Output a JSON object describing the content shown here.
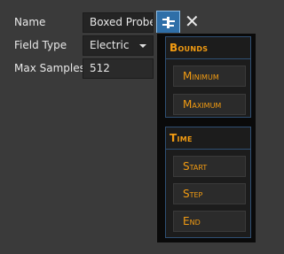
{
  "form": {
    "name_label": "Name",
    "name_value": "Boxed Probe",
    "field_type_label": "Field Type",
    "field_type_value": "Electric",
    "max_samples_label": "Max Samples",
    "max_samples_value": "512"
  },
  "header_icons": {
    "toggle_icon": "column-toggle-icon",
    "close_icon": "close-icon",
    "close_glyph": "✕"
  },
  "menu": {
    "bounds_title": "Bounds",
    "bounds_items": [
      "Minimum",
      "Maximum"
    ],
    "time_title": "Time",
    "time_items": [
      "Start",
      "Step",
      "End"
    ]
  },
  "colors": {
    "background": "#3a3a3a",
    "accent_orange": "#f39c12",
    "section_border": "#2f4f73",
    "toggle_blue": "#2f6fa8"
  }
}
